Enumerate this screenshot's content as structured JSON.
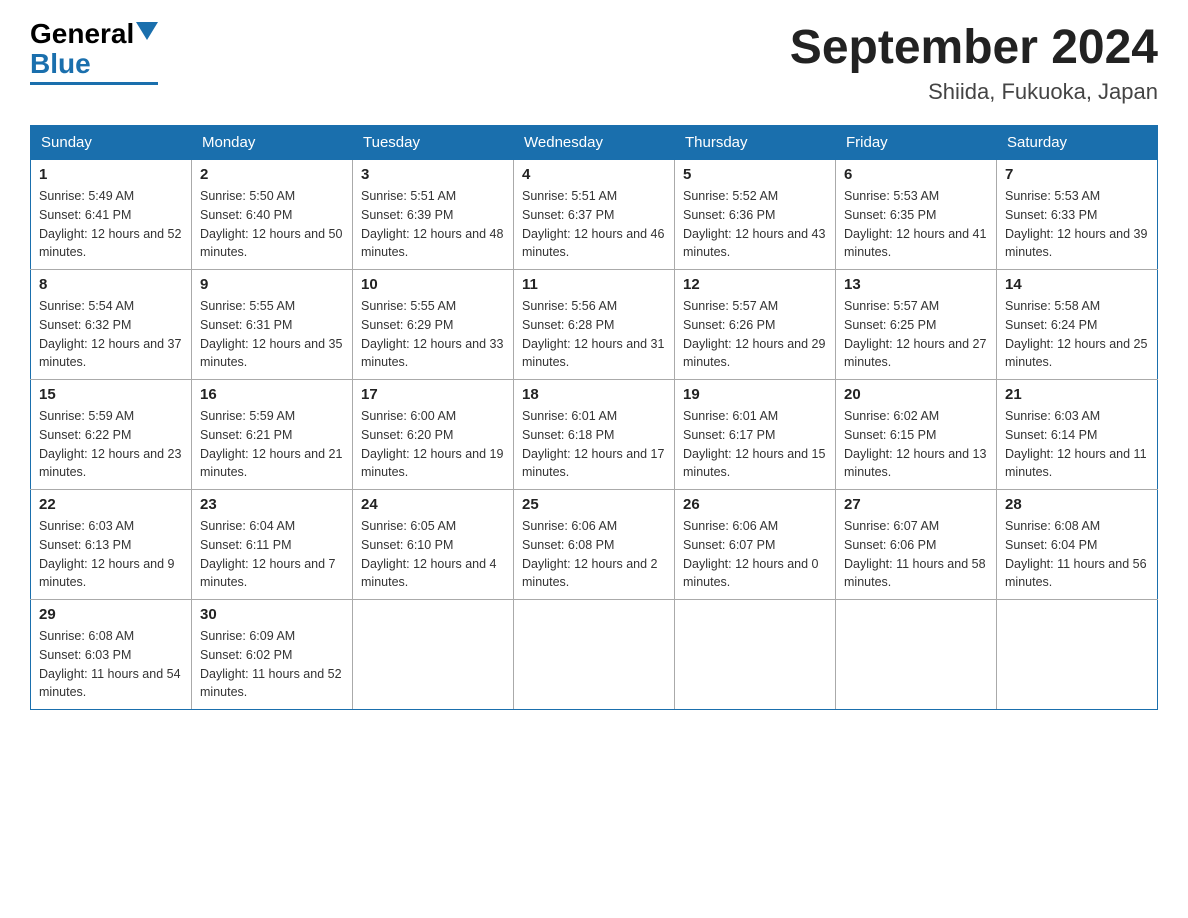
{
  "logo": {
    "general": "General",
    "blue": "Blue"
  },
  "title": "September 2024",
  "location": "Shiida, Fukuoka, Japan",
  "days_of_week": [
    "Sunday",
    "Monday",
    "Tuesday",
    "Wednesday",
    "Thursday",
    "Friday",
    "Saturday"
  ],
  "weeks": [
    [
      {
        "day": "1",
        "sunrise": "5:49 AM",
        "sunset": "6:41 PM",
        "daylight": "12 hours and 52 minutes."
      },
      {
        "day": "2",
        "sunrise": "5:50 AM",
        "sunset": "6:40 PM",
        "daylight": "12 hours and 50 minutes."
      },
      {
        "day": "3",
        "sunrise": "5:51 AM",
        "sunset": "6:39 PM",
        "daylight": "12 hours and 48 minutes."
      },
      {
        "day": "4",
        "sunrise": "5:51 AM",
        "sunset": "6:37 PM",
        "daylight": "12 hours and 46 minutes."
      },
      {
        "day": "5",
        "sunrise": "5:52 AM",
        "sunset": "6:36 PM",
        "daylight": "12 hours and 43 minutes."
      },
      {
        "day": "6",
        "sunrise": "5:53 AM",
        "sunset": "6:35 PM",
        "daylight": "12 hours and 41 minutes."
      },
      {
        "day": "7",
        "sunrise": "5:53 AM",
        "sunset": "6:33 PM",
        "daylight": "12 hours and 39 minutes."
      }
    ],
    [
      {
        "day": "8",
        "sunrise": "5:54 AM",
        "sunset": "6:32 PM",
        "daylight": "12 hours and 37 minutes."
      },
      {
        "day": "9",
        "sunrise": "5:55 AM",
        "sunset": "6:31 PM",
        "daylight": "12 hours and 35 minutes."
      },
      {
        "day": "10",
        "sunrise": "5:55 AM",
        "sunset": "6:29 PM",
        "daylight": "12 hours and 33 minutes."
      },
      {
        "day": "11",
        "sunrise": "5:56 AM",
        "sunset": "6:28 PM",
        "daylight": "12 hours and 31 minutes."
      },
      {
        "day": "12",
        "sunrise": "5:57 AM",
        "sunset": "6:26 PM",
        "daylight": "12 hours and 29 minutes."
      },
      {
        "day": "13",
        "sunrise": "5:57 AM",
        "sunset": "6:25 PM",
        "daylight": "12 hours and 27 minutes."
      },
      {
        "day": "14",
        "sunrise": "5:58 AM",
        "sunset": "6:24 PM",
        "daylight": "12 hours and 25 minutes."
      }
    ],
    [
      {
        "day": "15",
        "sunrise": "5:59 AM",
        "sunset": "6:22 PM",
        "daylight": "12 hours and 23 minutes."
      },
      {
        "day": "16",
        "sunrise": "5:59 AM",
        "sunset": "6:21 PM",
        "daylight": "12 hours and 21 minutes."
      },
      {
        "day": "17",
        "sunrise": "6:00 AM",
        "sunset": "6:20 PM",
        "daylight": "12 hours and 19 minutes."
      },
      {
        "day": "18",
        "sunrise": "6:01 AM",
        "sunset": "6:18 PM",
        "daylight": "12 hours and 17 minutes."
      },
      {
        "day": "19",
        "sunrise": "6:01 AM",
        "sunset": "6:17 PM",
        "daylight": "12 hours and 15 minutes."
      },
      {
        "day": "20",
        "sunrise": "6:02 AM",
        "sunset": "6:15 PM",
        "daylight": "12 hours and 13 minutes."
      },
      {
        "day": "21",
        "sunrise": "6:03 AM",
        "sunset": "6:14 PM",
        "daylight": "12 hours and 11 minutes."
      }
    ],
    [
      {
        "day": "22",
        "sunrise": "6:03 AM",
        "sunset": "6:13 PM",
        "daylight": "12 hours and 9 minutes."
      },
      {
        "day": "23",
        "sunrise": "6:04 AM",
        "sunset": "6:11 PM",
        "daylight": "12 hours and 7 minutes."
      },
      {
        "day": "24",
        "sunrise": "6:05 AM",
        "sunset": "6:10 PM",
        "daylight": "12 hours and 4 minutes."
      },
      {
        "day": "25",
        "sunrise": "6:06 AM",
        "sunset": "6:08 PM",
        "daylight": "12 hours and 2 minutes."
      },
      {
        "day": "26",
        "sunrise": "6:06 AM",
        "sunset": "6:07 PM",
        "daylight": "12 hours and 0 minutes."
      },
      {
        "day": "27",
        "sunrise": "6:07 AM",
        "sunset": "6:06 PM",
        "daylight": "11 hours and 58 minutes."
      },
      {
        "day": "28",
        "sunrise": "6:08 AM",
        "sunset": "6:04 PM",
        "daylight": "11 hours and 56 minutes."
      }
    ],
    [
      {
        "day": "29",
        "sunrise": "6:08 AM",
        "sunset": "6:03 PM",
        "daylight": "11 hours and 54 minutes."
      },
      {
        "day": "30",
        "sunrise": "6:09 AM",
        "sunset": "6:02 PM",
        "daylight": "11 hours and 52 minutes."
      },
      null,
      null,
      null,
      null,
      null
    ]
  ]
}
